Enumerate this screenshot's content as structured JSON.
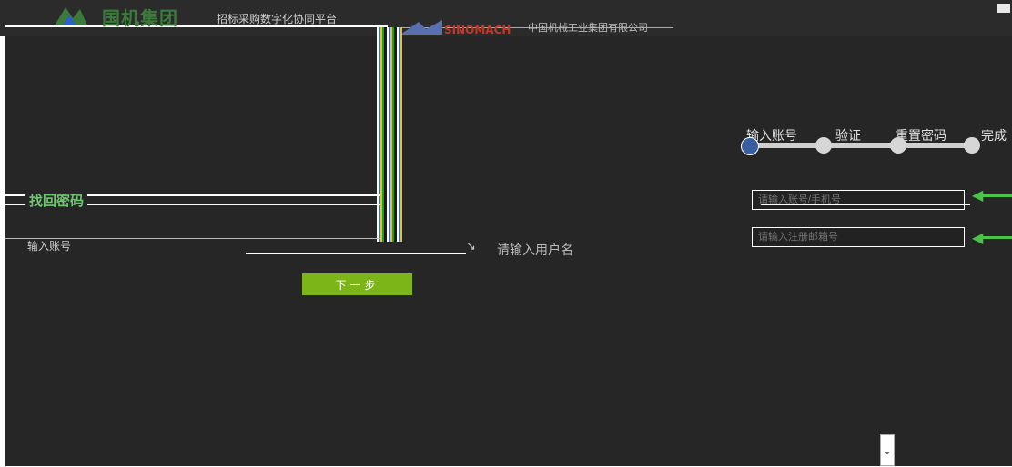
{
  "header": {
    "title": "国机集团",
    "subtitle": "招标采购数字化协同平台",
    "sinomach": "SINOMACH",
    "extra": "中国机械工业集团有限公司"
  },
  "left_panel": {
    "title": "找回密码",
    "account_label": "输入账号",
    "account_value": "",
    "hint_text": "请输入用户名",
    "next_label": "下一步"
  },
  "steps": {
    "items": [
      "输入账号",
      "验证",
      "重置密码",
      "完成"
    ],
    "current": 0
  },
  "right_form": {
    "phone_placeholder": "请输入账号/手机号",
    "code_placeholder": "请输入注册邮箱号"
  },
  "scroll": {
    "icon": "chevron-down-icon",
    "glyph": "⌄"
  },
  "colors": {
    "accent_green": "#7cb518",
    "brand_green": "#3a7b3a",
    "step_active": "#3a5f9e",
    "background_dark": "#262626"
  }
}
